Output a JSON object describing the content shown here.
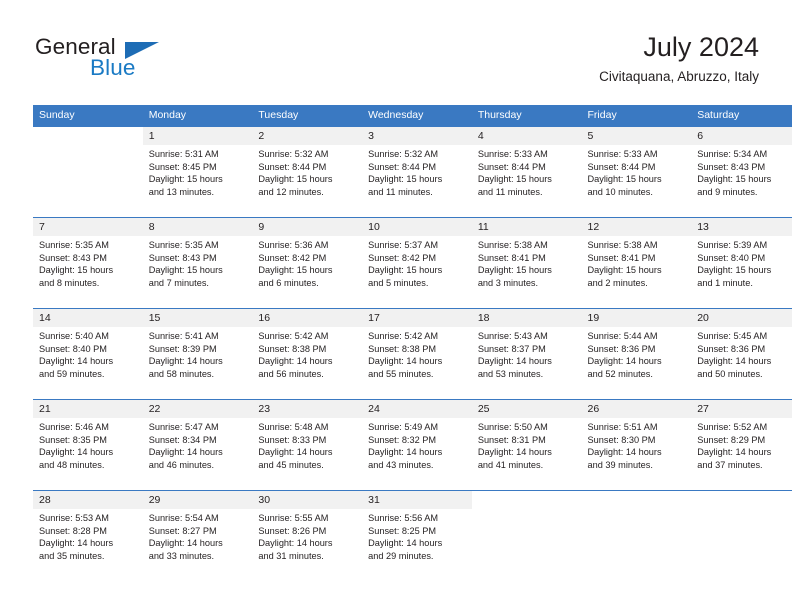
{
  "brand": {
    "name_part1": "General",
    "name_part2": "Blue",
    "accent_color": "#1a7ac4",
    "flag_color": "#1d6cb5"
  },
  "header": {
    "title": "July 2024",
    "subtitle": "Civitaquana, Abruzzo, Italy"
  },
  "theme": {
    "header_bg": "#3a79c2",
    "daynum_bg": "#f1f1f1",
    "text_color": "#231f20"
  },
  "weekdays": [
    "Sunday",
    "Monday",
    "Tuesday",
    "Wednesday",
    "Thursday",
    "Friday",
    "Saturday"
  ],
  "weeks": [
    [
      {
        "day": "",
        "lines": []
      },
      {
        "day": "1",
        "lines": [
          "Sunrise: 5:31 AM",
          "Sunset: 8:45 PM",
          "Daylight: 15 hours",
          "and 13 minutes."
        ]
      },
      {
        "day": "2",
        "lines": [
          "Sunrise: 5:32 AM",
          "Sunset: 8:44 PM",
          "Daylight: 15 hours",
          "and 12 minutes."
        ]
      },
      {
        "day": "3",
        "lines": [
          "Sunrise: 5:32 AM",
          "Sunset: 8:44 PM",
          "Daylight: 15 hours",
          "and 11 minutes."
        ]
      },
      {
        "day": "4",
        "lines": [
          "Sunrise: 5:33 AM",
          "Sunset: 8:44 PM",
          "Daylight: 15 hours",
          "and 11 minutes."
        ]
      },
      {
        "day": "5",
        "lines": [
          "Sunrise: 5:33 AM",
          "Sunset: 8:44 PM",
          "Daylight: 15 hours",
          "and 10 minutes."
        ]
      },
      {
        "day": "6",
        "lines": [
          "Sunrise: 5:34 AM",
          "Sunset: 8:43 PM",
          "Daylight: 15 hours",
          "and 9 minutes."
        ]
      }
    ],
    [
      {
        "day": "7",
        "lines": [
          "Sunrise: 5:35 AM",
          "Sunset: 8:43 PM",
          "Daylight: 15 hours",
          "and 8 minutes."
        ]
      },
      {
        "day": "8",
        "lines": [
          "Sunrise: 5:35 AM",
          "Sunset: 8:43 PM",
          "Daylight: 15 hours",
          "and 7 minutes."
        ]
      },
      {
        "day": "9",
        "lines": [
          "Sunrise: 5:36 AM",
          "Sunset: 8:42 PM",
          "Daylight: 15 hours",
          "and 6 minutes."
        ]
      },
      {
        "day": "10",
        "lines": [
          "Sunrise: 5:37 AM",
          "Sunset: 8:42 PM",
          "Daylight: 15 hours",
          "and 5 minutes."
        ]
      },
      {
        "day": "11",
        "lines": [
          "Sunrise: 5:38 AM",
          "Sunset: 8:41 PM",
          "Daylight: 15 hours",
          "and 3 minutes."
        ]
      },
      {
        "day": "12",
        "lines": [
          "Sunrise: 5:38 AM",
          "Sunset: 8:41 PM",
          "Daylight: 15 hours",
          "and 2 minutes."
        ]
      },
      {
        "day": "13",
        "lines": [
          "Sunrise: 5:39 AM",
          "Sunset: 8:40 PM",
          "Daylight: 15 hours",
          "and 1 minute."
        ]
      }
    ],
    [
      {
        "day": "14",
        "lines": [
          "Sunrise: 5:40 AM",
          "Sunset: 8:40 PM",
          "Daylight: 14 hours",
          "and 59 minutes."
        ]
      },
      {
        "day": "15",
        "lines": [
          "Sunrise: 5:41 AM",
          "Sunset: 8:39 PM",
          "Daylight: 14 hours",
          "and 58 minutes."
        ]
      },
      {
        "day": "16",
        "lines": [
          "Sunrise: 5:42 AM",
          "Sunset: 8:38 PM",
          "Daylight: 14 hours",
          "and 56 minutes."
        ]
      },
      {
        "day": "17",
        "lines": [
          "Sunrise: 5:42 AM",
          "Sunset: 8:38 PM",
          "Daylight: 14 hours",
          "and 55 minutes."
        ]
      },
      {
        "day": "18",
        "lines": [
          "Sunrise: 5:43 AM",
          "Sunset: 8:37 PM",
          "Daylight: 14 hours",
          "and 53 minutes."
        ]
      },
      {
        "day": "19",
        "lines": [
          "Sunrise: 5:44 AM",
          "Sunset: 8:36 PM",
          "Daylight: 14 hours",
          "and 52 minutes."
        ]
      },
      {
        "day": "20",
        "lines": [
          "Sunrise: 5:45 AM",
          "Sunset: 8:36 PM",
          "Daylight: 14 hours",
          "and 50 minutes."
        ]
      }
    ],
    [
      {
        "day": "21",
        "lines": [
          "Sunrise: 5:46 AM",
          "Sunset: 8:35 PM",
          "Daylight: 14 hours",
          "and 48 minutes."
        ]
      },
      {
        "day": "22",
        "lines": [
          "Sunrise: 5:47 AM",
          "Sunset: 8:34 PM",
          "Daylight: 14 hours",
          "and 46 minutes."
        ]
      },
      {
        "day": "23",
        "lines": [
          "Sunrise: 5:48 AM",
          "Sunset: 8:33 PM",
          "Daylight: 14 hours",
          "and 45 minutes."
        ]
      },
      {
        "day": "24",
        "lines": [
          "Sunrise: 5:49 AM",
          "Sunset: 8:32 PM",
          "Daylight: 14 hours",
          "and 43 minutes."
        ]
      },
      {
        "day": "25",
        "lines": [
          "Sunrise: 5:50 AM",
          "Sunset: 8:31 PM",
          "Daylight: 14 hours",
          "and 41 minutes."
        ]
      },
      {
        "day": "26",
        "lines": [
          "Sunrise: 5:51 AM",
          "Sunset: 8:30 PM",
          "Daylight: 14 hours",
          "and 39 minutes."
        ]
      },
      {
        "day": "27",
        "lines": [
          "Sunrise: 5:52 AM",
          "Sunset: 8:29 PM",
          "Daylight: 14 hours",
          "and 37 minutes."
        ]
      }
    ],
    [
      {
        "day": "28",
        "lines": [
          "Sunrise: 5:53 AM",
          "Sunset: 8:28 PM",
          "Daylight: 14 hours",
          "and 35 minutes."
        ]
      },
      {
        "day": "29",
        "lines": [
          "Sunrise: 5:54 AM",
          "Sunset: 8:27 PM",
          "Daylight: 14 hours",
          "and 33 minutes."
        ]
      },
      {
        "day": "30",
        "lines": [
          "Sunrise: 5:55 AM",
          "Sunset: 8:26 PM",
          "Daylight: 14 hours",
          "and 31 minutes."
        ]
      },
      {
        "day": "31",
        "lines": [
          "Sunrise: 5:56 AM",
          "Sunset: 8:25 PM",
          "Daylight: 14 hours",
          "and 29 minutes."
        ]
      },
      {
        "day": "",
        "lines": []
      },
      {
        "day": "",
        "lines": []
      },
      {
        "day": "",
        "lines": []
      }
    ]
  ]
}
